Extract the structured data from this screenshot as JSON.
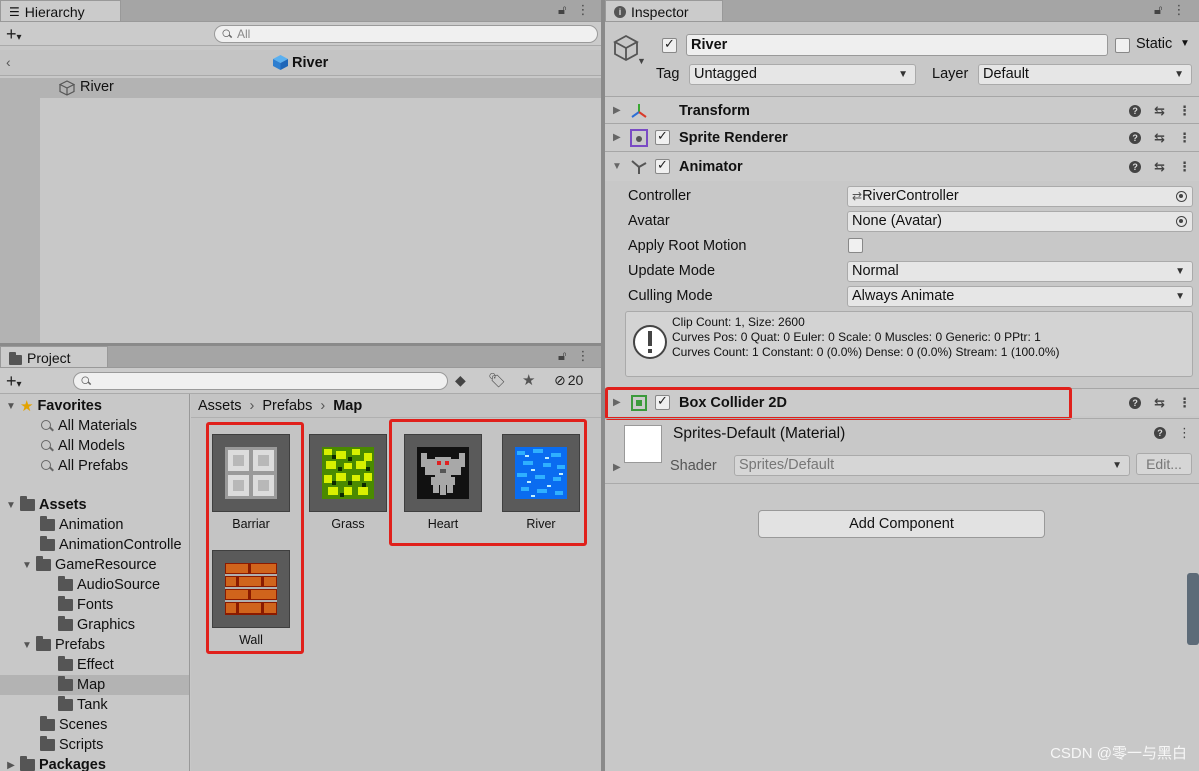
{
  "hierarchy": {
    "tab_label": "Hierarchy",
    "search_placeholder": "All",
    "scene_title": "River",
    "items": [
      {
        "label": "River"
      }
    ]
  },
  "project": {
    "tab_label": "Project",
    "hidden_count": "20",
    "tree": {
      "favorites_label": "Favorites",
      "favorites": [
        "All Materials",
        "All Models",
        "All Prefabs"
      ],
      "assets_label": "Assets",
      "folders": {
        "animation": "Animation",
        "animation_controller": "AnimationControlle",
        "game_resource": "GameResource",
        "audio_source": "AudioSource",
        "fonts": "Fonts",
        "graphics": "Graphics",
        "prefabs": "Prefabs",
        "effect": "Effect",
        "map": "Map",
        "tank": "Tank",
        "scenes": "Scenes",
        "scripts": "Scripts"
      },
      "packages_label": "Packages"
    },
    "breadcrumb": [
      "Assets",
      "Prefabs",
      "Map"
    ],
    "assets": [
      {
        "name": "Barriar"
      },
      {
        "name": "Grass"
      },
      {
        "name": "Heart"
      },
      {
        "name": "River"
      },
      {
        "name": "Wall"
      }
    ]
  },
  "inspector": {
    "tab_label": "Inspector",
    "object_name": "River",
    "static_label": "Static",
    "tag_label": "Tag",
    "tag_value": "Untagged",
    "layer_label": "Layer",
    "layer_value": "Default",
    "components": {
      "transform": "Transform",
      "sprite_renderer": "Sprite Renderer",
      "animator": "Animator",
      "box_collider": "Box Collider 2D"
    },
    "animator": {
      "controller_label": "Controller",
      "controller_value": "RiverController",
      "avatar_label": "Avatar",
      "avatar_value": "None (Avatar)",
      "apply_root_motion_label": "Apply Root Motion",
      "update_mode_label": "Update Mode",
      "update_mode_value": "Normal",
      "culling_mode_label": "Culling Mode",
      "culling_mode_value": "Always Animate",
      "info_line1": "Clip Count: 1, Size: 2600",
      "info_line2": "Curves Pos: 0 Quat: 0 Euler: 0 Scale: 0 Muscles: 0 Generic: 0 PPtr: 1",
      "info_line3": "Curves Count: 1 Constant: 0 (0.0%) Dense: 0 (0.0%) Stream: 1 (100.0%)"
    },
    "material": {
      "name": "Sprites-Default (Material)",
      "shader_label": "Shader",
      "shader_value": "Sprites/Default",
      "edit_label": "Edit..."
    },
    "add_component_label": "Add Component"
  },
  "watermark": "CSDN @零一与黑白",
  "colors": {
    "highlight_box": "#e0201b",
    "panel_bg": "#c8c8c8"
  }
}
